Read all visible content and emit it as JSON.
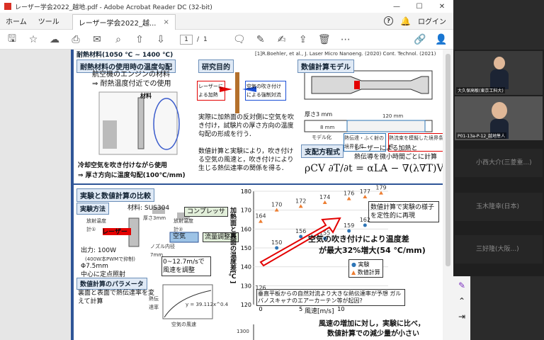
{
  "window": {
    "title": "レーザー学会2022_越地.pdf - Adobe Acrobat Reader DC (32-bit)",
    "minimize": "—",
    "maximize": "☐",
    "close": "✕"
  },
  "menu": {
    "home": "ホーム",
    "tools": "ツール",
    "doc_tab": "レーザー学会2022_越...",
    "tab_close": "×",
    "login": "ログイン"
  },
  "toolbar": {
    "page_current": "1",
    "page_sep": "/",
    "page_total": "1"
  },
  "slide": {
    "top_note": "耐熱材料(1050 ℃ ~ 1400 ℃)",
    "refs": "[1]R.Boehler, et al., J. Laser Micro Nanoeng. (2020)     Cont. Technol. (2021)",
    "sec1": {
      "header": "耐熱材料の使用時の温度勾配",
      "line1": "航空機のエンジンの材料",
      "line2": "⇒ 耐熱温度付近での使用",
      "label_material": "材料",
      "bottom1": "冷却空気を吹き付けながら使用",
      "bottom2": "⇒ 厚さ方向に温度勾配(100℃/mm)"
    },
    "sec2": {
      "header": "研究目的",
      "laser_heat": "レーザーによる加熱",
      "air_cool": "空気の吹き付けによる強制対流",
      "b1": "実際に加熱面の反対側に空気を吹き付け，試験片の厚さ方向の温度勾配の形成を行う．",
      "b2": "数値計算と実験により，吹き付ける空気の風速と，吹き付けにより生じる熱伝達率の関係を得る．"
    },
    "sec3": {
      "header": "数値計算モデル",
      "thick": "厚さ3 mm",
      "model": "モデル化",
      "dim1": "120 mm",
      "dim2": "8 mm",
      "legend1": "熱伝達・ふく射の境界条件",
      "legend2": "熱流束を模擬した境界条件",
      "gov_header": "支配方程式",
      "gov_text1": "レーザーによる加熱と",
      "gov_text2": "熱伝導を微小時間ごとに計算",
      "equation": "ρCV ∂T/∂t = αLA − ∇(λ∇T)V"
    },
    "sec4": {
      "header": "実験と数値計算の比較",
      "method": "実験方法",
      "material": "材料: SUS304",
      "thermo1": "放射温度計①",
      "thermo2": "放射温度計②",
      "thick3": "厚さ3mm",
      "compressor": "コンプレッサ",
      "laser": "レーザー",
      "air": "空気",
      "flowvalve": "流量調整弁",
      "nozzle": "ノズル内径7mm",
      "out1": "出力: 100W",
      "out1b": "(400W本PWMで抑制)",
      "out2": "Φ7.5mm",
      "out3": "中心に定点照射",
      "wind": "0~12.7m/sで風速を調整",
      "param_header": "数値計算のパラメータ",
      "param_text": "裏面と表面で熱伝達率を変えて計算"
    },
    "chart_note": "数値計算で実験の様子を定性的に再現",
    "big_red1": "空気の吹き付けにより温度差",
    "big_red2": "が最大32%増大(54 ℃/mm)",
    "nat_conv": "垂直平板からの自然対流より大きな熱伝達率が予想 ガルバノスキャナのエアーカーテン等が起因?",
    "bottom_red1": "風速の増加に対し，実験に比べ，",
    "bottom_red2": "数値計算での減少量が小さい",
    "ylabel_small": "熱伝達率",
    "xlabel_small": "空気の風速",
    "fit": "y = 39.112x^0.4"
  },
  "chart_data": {
    "type": "scatter",
    "xlabel": "風速[m/s]",
    "ylabel": "加熱面と裏面の温度差[℃]",
    "xlim": [
      0,
      15
    ],
    "ylim": [
      120,
      180
    ],
    "yticks": [
      120,
      130,
      140,
      150,
      160,
      170,
      180
    ],
    "xticks": [
      0,
      5,
      10
    ],
    "series": [
      {
        "name": "実験",
        "color": "#2e75b6",
        "x": [
          0,
          2,
          5,
          8,
          11,
          13
        ],
        "y": [
          126,
          150,
          156,
          155,
          159,
          162
        ]
      },
      {
        "name": "数値計算",
        "color": "#ed7d31",
        "x": [
          0,
          2,
          5,
          8,
          11,
          13,
          15
        ],
        "y": [
          164,
          170,
          172,
          174,
          176,
          177,
          179
        ]
      }
    ],
    "lower_chart_ytick": "1300"
  },
  "video": {
    "p1": "大久保高敏(東京工科大)",
    "p2": "P01-13a-P-12_越地隼人",
    "p3": "小西大介(三菱重...)",
    "p4": "玉木隆幸(日本)",
    "p5": "三好隆(大阪...)"
  }
}
